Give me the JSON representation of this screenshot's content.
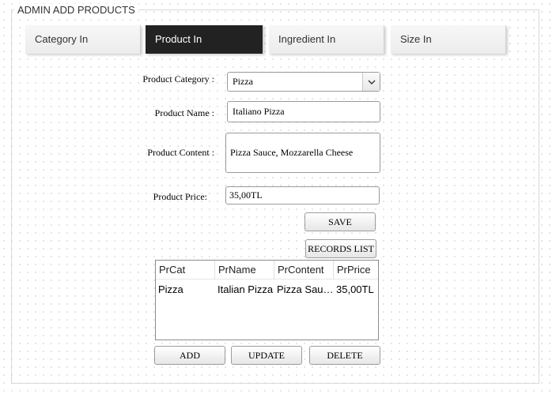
{
  "frame_title": "ADMIN ADD PRODUCTS",
  "tabs": [
    {
      "label": "Category In"
    },
    {
      "label": "Product In"
    },
    {
      "label": "Ingredient In"
    },
    {
      "label": "Size In"
    }
  ],
  "active_tab": "Product In",
  "form": {
    "category_label": "Product Category :",
    "category_value": "Pizza",
    "name_label": "Product Name :",
    "name_value": "Italiano Pizza",
    "content_label": "Product Content :",
    "content_value": "Pizza Sauce, Mozzarella Cheese",
    "price_label": "Product Price:",
    "price_value": "35,00TL"
  },
  "buttons": {
    "save": "SAVE",
    "records_list": "RECORDS LIST",
    "add": "ADD",
    "update": "UPDATE",
    "delete": "DELETE"
  },
  "table": {
    "headers": [
      "PrCat",
      "PrName",
      "PrContent",
      "PrPrice"
    ],
    "rows": [
      [
        "Pizza",
        "Italian Pizza",
        "Pizza Sauce, Mozzarella Cheese",
        "35,00TL"
      ]
    ]
  },
  "icons": {
    "dropdown": "chevron-down-icon"
  }
}
